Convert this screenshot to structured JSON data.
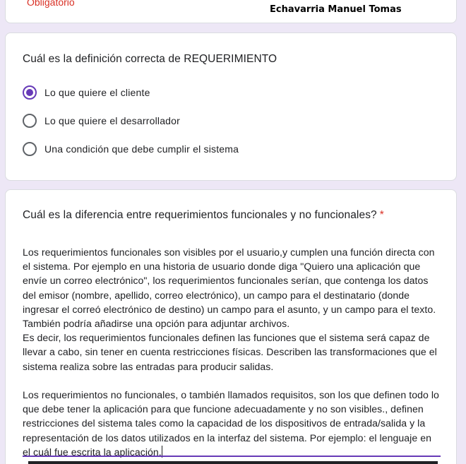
{
  "header_card": {
    "required_note": "Obligatorio",
    "student_name": "Echavarria Manuel Tomas"
  },
  "question_1": {
    "title": "Cuál es la definición correcta de REQUERIMIENTO",
    "options": [
      {
        "label": "Lo que quiere el cliente",
        "selected": true
      },
      {
        "label": "Lo que quiere el desarrollador",
        "selected": false
      },
      {
        "label": "Una condición que debe cumplir el sistema",
        "selected": false
      }
    ]
  },
  "question_2": {
    "title": "Cuál es la diferencia entre requerimientos funcionales y no funcionales?",
    "required_mark": "*",
    "answer": "Los requerimientos funcionales son visibles por el usuario,y cumplen una función directa con el sistema. Por ejemplo en una historia de usuario donde diga \"Quiero una aplicación que envíe un correo electrónico\", los requerimientos funcionales serían, que contenga los datos del emisor (nombre, apellido, correo electrónico), un campo para el destinatario (donde ingresar el correó electrónico de destino) un campo para el asunto, y un campo para el texto. También podría añadirse una opción para adjuntar archivos.\nEs decir, los requerimientos funcionales definen las funciones que el sistema será capaz de llevar a cabo, sin tener en cuenta restricciones físicas. Describen las transformaciones que el sistema realiza sobre las entradas para producir salidas.\n\nLos requerimientos no funcionales, o también llamados requisitos, son los que definen todo lo que debe tener la aplicación para que funcione adecuadamente y no son visibles., definen restricciones del sistema tales como la capacidad de los dispositivos de entrada/salida y la representación de los datos utilizados en la interfaz del sistema. Por ejemplo: el lenguaje en el cuál fue escrita la aplicación."
  },
  "colors": {
    "accent": "#673ab7",
    "required": "#d93025",
    "background": "#ede7f6",
    "card": "#ffffff"
  }
}
